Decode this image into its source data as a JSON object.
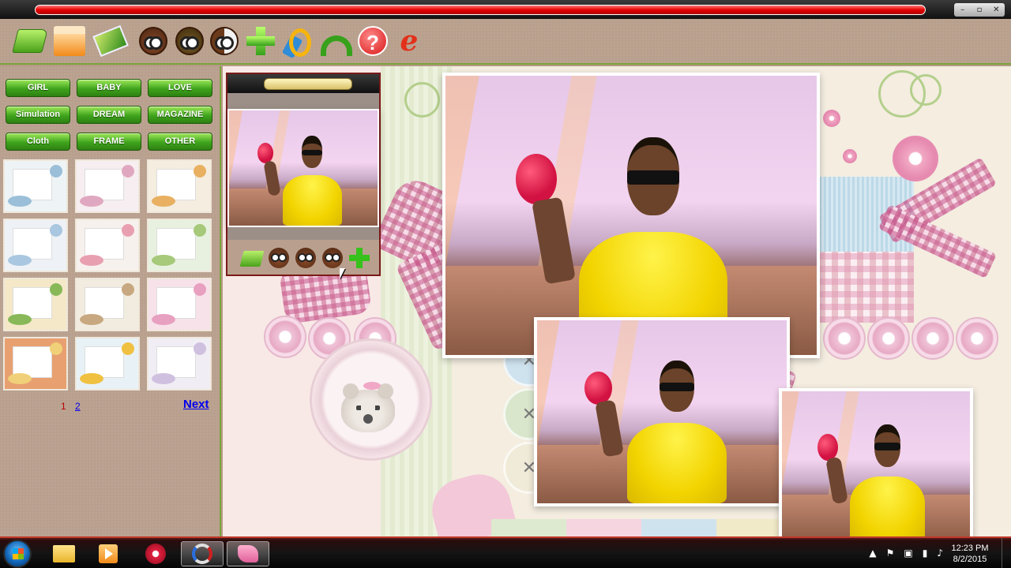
{
  "window": {
    "controls": [
      "–",
      "▫",
      "✕"
    ]
  },
  "toolbar": {
    "tools": [
      {
        "name": "open-folder-icon"
      },
      {
        "name": "box-icon"
      },
      {
        "name": "note-icon"
      },
      {
        "name": "owl-icon-1"
      },
      {
        "name": "owl-icon-2"
      },
      {
        "name": "owl-icon-3"
      },
      {
        "name": "move-icon"
      },
      {
        "name": "brush-icon"
      },
      {
        "name": "undo-icon"
      },
      {
        "name": "help-icon",
        "glyph": "?"
      },
      {
        "name": "ie-icon",
        "glyph": "e"
      }
    ]
  },
  "categories": [
    "GIRL",
    "BABY",
    "LOVE",
    "Simulation",
    "DREAM",
    "MAGAZINE",
    "Cloth",
    "FRAME",
    "OTHER"
  ],
  "templates": [
    {
      "tint": "#eef3f6",
      "accent": "#9bbfd8"
    },
    {
      "tint": "#f6eef0",
      "accent": "#e0a8c0"
    },
    {
      "tint": "#f4ede0",
      "accent": "#e8b060"
    },
    {
      "tint": "#eef2f6",
      "accent": "#a9c7e0"
    },
    {
      "tint": "#f7f1ee",
      "accent": "#e8a0b0"
    },
    {
      "tint": "#e8f1e0",
      "accent": "#a6c97a"
    },
    {
      "tint": "#f4e8c8",
      "accent": "#88b858"
    },
    {
      "tint": "#f2ece0",
      "accent": "#c8a880"
    },
    {
      "tint": "#f7e2ea",
      "accent": "#e8a0c0"
    },
    {
      "tint": "#e8a070",
      "accent": "#f0d078"
    },
    {
      "tint": "#e8f2f6",
      "accent": "#f0c040"
    },
    {
      "tint": "#f0eef4",
      "accent": "#d0c0e0"
    }
  ],
  "pagination": {
    "current": "1",
    "other": "2",
    "next_label": "Next"
  },
  "taskbar": {
    "apps": [
      "windows-explorer",
      "media-player",
      "itunes",
      "snagit",
      "photo-collage-app"
    ],
    "tray_icons": [
      "▲",
      "⚑",
      "▣",
      "▮",
      "♪"
    ],
    "time": "12:23 PM",
    "date": "8/2/2015"
  }
}
